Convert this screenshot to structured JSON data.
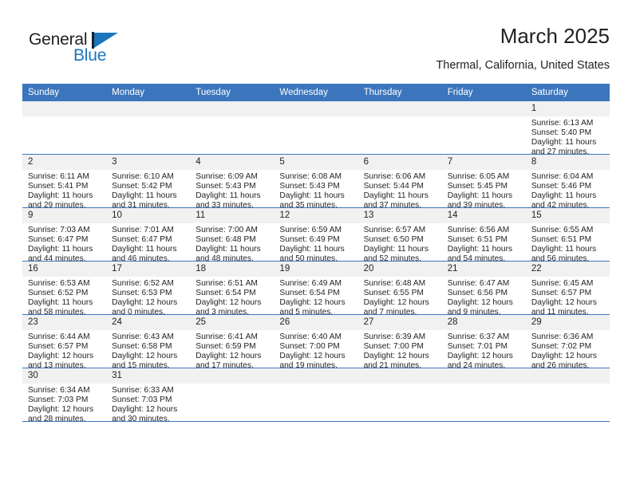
{
  "brand": {
    "name_top": "General",
    "name_bottom": "Blue",
    "accent_color": "#1b75bc"
  },
  "header": {
    "title": "March 2025",
    "subtitle": "Thermal, California, United States"
  },
  "theme": {
    "header_bg": "#3b76bc",
    "daynum_bg": "#f1f1f1",
    "grid_line": "#3b76bc",
    "text": "#231f20"
  },
  "calendar": {
    "weekday_headers": [
      "Sunday",
      "Monday",
      "Tuesday",
      "Wednesday",
      "Thursday",
      "Friday",
      "Saturday"
    ],
    "weeks": [
      [
        {
          "day": "",
          "lines": []
        },
        {
          "day": "",
          "lines": []
        },
        {
          "day": "",
          "lines": []
        },
        {
          "day": "",
          "lines": []
        },
        {
          "day": "",
          "lines": []
        },
        {
          "day": "",
          "lines": []
        },
        {
          "day": "1",
          "lines": [
            "Sunrise: 6:13 AM",
            "Sunset: 5:40 PM",
            "Daylight: 11 hours",
            "and 27 minutes."
          ]
        }
      ],
      [
        {
          "day": "2",
          "lines": [
            "Sunrise: 6:11 AM",
            "Sunset: 5:41 PM",
            "Daylight: 11 hours",
            "and 29 minutes."
          ]
        },
        {
          "day": "3",
          "lines": [
            "Sunrise: 6:10 AM",
            "Sunset: 5:42 PM",
            "Daylight: 11 hours",
            "and 31 minutes."
          ]
        },
        {
          "day": "4",
          "lines": [
            "Sunrise: 6:09 AM",
            "Sunset: 5:43 PM",
            "Daylight: 11 hours",
            "and 33 minutes."
          ]
        },
        {
          "day": "5",
          "lines": [
            "Sunrise: 6:08 AM",
            "Sunset: 5:43 PM",
            "Daylight: 11 hours",
            "and 35 minutes."
          ]
        },
        {
          "day": "6",
          "lines": [
            "Sunrise: 6:06 AM",
            "Sunset: 5:44 PM",
            "Daylight: 11 hours",
            "and 37 minutes."
          ]
        },
        {
          "day": "7",
          "lines": [
            "Sunrise: 6:05 AM",
            "Sunset: 5:45 PM",
            "Daylight: 11 hours",
            "and 39 minutes."
          ]
        },
        {
          "day": "8",
          "lines": [
            "Sunrise: 6:04 AM",
            "Sunset: 5:46 PM",
            "Daylight: 11 hours",
            "and 42 minutes."
          ]
        }
      ],
      [
        {
          "day": "9",
          "lines": [
            "Sunrise: 7:03 AM",
            "Sunset: 6:47 PM",
            "Daylight: 11 hours",
            "and 44 minutes."
          ]
        },
        {
          "day": "10",
          "lines": [
            "Sunrise: 7:01 AM",
            "Sunset: 6:47 PM",
            "Daylight: 11 hours",
            "and 46 minutes."
          ]
        },
        {
          "day": "11",
          "lines": [
            "Sunrise: 7:00 AM",
            "Sunset: 6:48 PM",
            "Daylight: 11 hours",
            "and 48 minutes."
          ]
        },
        {
          "day": "12",
          "lines": [
            "Sunrise: 6:59 AM",
            "Sunset: 6:49 PM",
            "Daylight: 11 hours",
            "and 50 minutes."
          ]
        },
        {
          "day": "13",
          "lines": [
            "Sunrise: 6:57 AM",
            "Sunset: 6:50 PM",
            "Daylight: 11 hours",
            "and 52 minutes."
          ]
        },
        {
          "day": "14",
          "lines": [
            "Sunrise: 6:56 AM",
            "Sunset: 6:51 PM",
            "Daylight: 11 hours",
            "and 54 minutes."
          ]
        },
        {
          "day": "15",
          "lines": [
            "Sunrise: 6:55 AM",
            "Sunset: 6:51 PM",
            "Daylight: 11 hours",
            "and 56 minutes."
          ]
        }
      ],
      [
        {
          "day": "16",
          "lines": [
            "Sunrise: 6:53 AM",
            "Sunset: 6:52 PM",
            "Daylight: 11 hours",
            "and 58 minutes."
          ]
        },
        {
          "day": "17",
          "lines": [
            "Sunrise: 6:52 AM",
            "Sunset: 6:53 PM",
            "Daylight: 12 hours",
            "and 0 minutes."
          ]
        },
        {
          "day": "18",
          "lines": [
            "Sunrise: 6:51 AM",
            "Sunset: 6:54 PM",
            "Daylight: 12 hours",
            "and 3 minutes."
          ]
        },
        {
          "day": "19",
          "lines": [
            "Sunrise: 6:49 AM",
            "Sunset: 6:54 PM",
            "Daylight: 12 hours",
            "and 5 minutes."
          ]
        },
        {
          "day": "20",
          "lines": [
            "Sunrise: 6:48 AM",
            "Sunset: 6:55 PM",
            "Daylight: 12 hours",
            "and 7 minutes."
          ]
        },
        {
          "day": "21",
          "lines": [
            "Sunrise: 6:47 AM",
            "Sunset: 6:56 PM",
            "Daylight: 12 hours",
            "and 9 minutes."
          ]
        },
        {
          "day": "22",
          "lines": [
            "Sunrise: 6:45 AM",
            "Sunset: 6:57 PM",
            "Daylight: 12 hours",
            "and 11 minutes."
          ]
        }
      ],
      [
        {
          "day": "23",
          "lines": [
            "Sunrise: 6:44 AM",
            "Sunset: 6:57 PM",
            "Daylight: 12 hours",
            "and 13 minutes."
          ]
        },
        {
          "day": "24",
          "lines": [
            "Sunrise: 6:43 AM",
            "Sunset: 6:58 PM",
            "Daylight: 12 hours",
            "and 15 minutes."
          ]
        },
        {
          "day": "25",
          "lines": [
            "Sunrise: 6:41 AM",
            "Sunset: 6:59 PM",
            "Daylight: 12 hours",
            "and 17 minutes."
          ]
        },
        {
          "day": "26",
          "lines": [
            "Sunrise: 6:40 AM",
            "Sunset: 7:00 PM",
            "Daylight: 12 hours",
            "and 19 minutes."
          ]
        },
        {
          "day": "27",
          "lines": [
            "Sunrise: 6:39 AM",
            "Sunset: 7:00 PM",
            "Daylight: 12 hours",
            "and 21 minutes."
          ]
        },
        {
          "day": "28",
          "lines": [
            "Sunrise: 6:37 AM",
            "Sunset: 7:01 PM",
            "Daylight: 12 hours",
            "and 24 minutes."
          ]
        },
        {
          "day": "29",
          "lines": [
            "Sunrise: 6:36 AM",
            "Sunset: 7:02 PM",
            "Daylight: 12 hours",
            "and 26 minutes."
          ]
        }
      ],
      [
        {
          "day": "30",
          "lines": [
            "Sunrise: 6:34 AM",
            "Sunset: 7:03 PM",
            "Daylight: 12 hours",
            "and 28 minutes."
          ]
        },
        {
          "day": "31",
          "lines": [
            "Sunrise: 6:33 AM",
            "Sunset: 7:03 PM",
            "Daylight: 12 hours",
            "and 30 minutes."
          ]
        },
        {
          "day": "",
          "lines": []
        },
        {
          "day": "",
          "lines": []
        },
        {
          "day": "",
          "lines": []
        },
        {
          "day": "",
          "lines": []
        },
        {
          "day": "",
          "lines": []
        }
      ]
    ]
  }
}
